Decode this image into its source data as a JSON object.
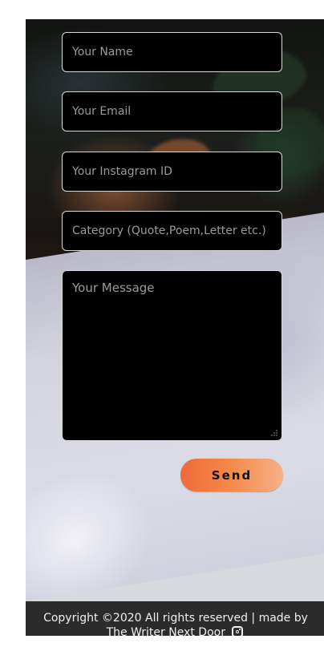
{
  "form": {
    "name_placeholder": "Your Name",
    "email_placeholder": "Your Email",
    "instagram_placeholder": "Your Instagram ID",
    "category_placeholder": "Category (Quote,Poem,Letter etc.)",
    "message_placeholder": "Your Message",
    "send_label": "Send"
  },
  "footer": {
    "line1": "Copyright ©2020 All rights reserved | made by",
    "line2": "The Writer Next Door",
    "icon": "instagram-icon"
  },
  "colors": {
    "field_background": "#000000",
    "field_border": "#d9d9d9",
    "placeholder_text": "#9a9a9a",
    "button_gradient_start": "#ef6a3a",
    "button_gradient_end": "#f7b089",
    "footer_background": "#2b2b2b"
  }
}
